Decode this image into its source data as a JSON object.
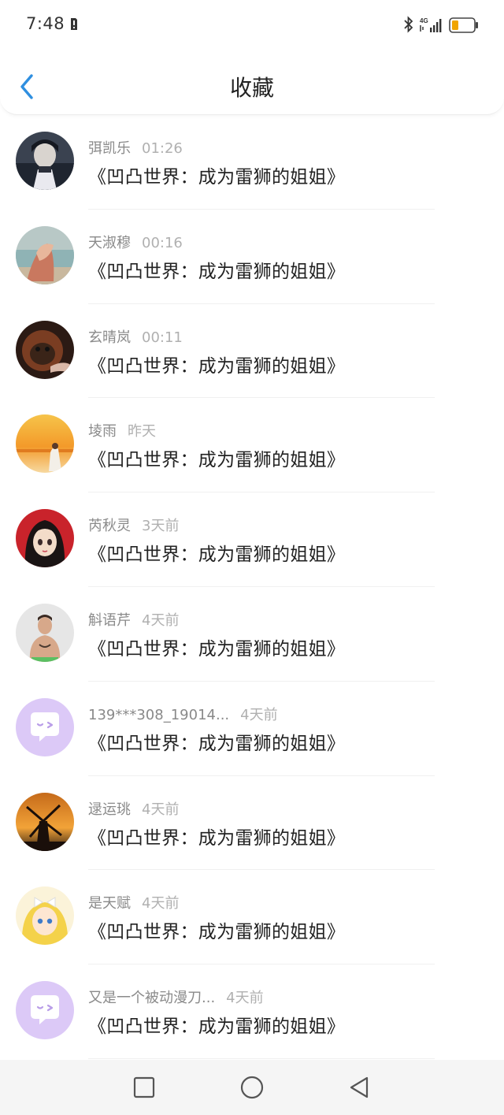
{
  "status_bar": {
    "time": "7:48",
    "icons": [
      "sim-alert-icon",
      "bluetooth-icon",
      "4g-signal-icon",
      "battery-low-icon"
    ],
    "network_label": "4G"
  },
  "header": {
    "title": "收藏",
    "back_icon": "chevron-left-icon"
  },
  "colors": {
    "accent": "#2f8fe0",
    "divider": "#f0f0f0",
    "meta_text": "#999999",
    "title_text": "#222222",
    "default_avatar": "#d9c6f5"
  },
  "items": [
    {
      "name": "弭凯乐",
      "time": "01:26",
      "title": "《凹凸世界：成为雷狮的姐姐》",
      "avatar": "anime-boy-avatar"
    },
    {
      "name": "天淑穆",
      "time": "00:16",
      "title": "《凹凸世界：成为雷狮的姐姐》",
      "avatar": "beach-photo-avatar"
    },
    {
      "name": "玄晴岚",
      "time": "00:11",
      "title": "《凹凸世界：成为雷狮的姐姐》",
      "avatar": "orangutan-avatar"
    },
    {
      "name": "堎雨",
      "time": "昨天",
      "title": "《凹凸世界：成为雷狮的姐姐》",
      "avatar": "sunset-girl-avatar"
    },
    {
      "name": "芮秋灵",
      "time": "3天前",
      "title": "《凹凸世界：成为雷狮的姐姐》",
      "avatar": "illustrated-girl-avatar"
    },
    {
      "name": "斛语芹",
      "time": "4天前",
      "title": "《凹凸世界：成为雷狮的姐姐》",
      "avatar": "tattoo-man-avatar"
    },
    {
      "name": "139***308_19014...",
      "time": "4天前",
      "title": "《凹凸世界：成为雷狮的姐姐》",
      "avatar": "default-chat-avatar"
    },
    {
      "name": "逯运珧",
      "time": "4天前",
      "title": "《凹凸世界：成为雷狮的姐姐》",
      "avatar": "windmill-sunset-avatar"
    },
    {
      "name": "是天赋",
      "time": "4天前",
      "title": "《凹凸世界：成为雷狮的姐姐》",
      "avatar": "anime-blonde-avatar"
    },
    {
      "name": "又是一个被动漫刀...",
      "time": "4天前",
      "title": "《凹凸世界：成为雷狮的姐姐》",
      "avatar": "default-chat-avatar"
    }
  ],
  "nav_bar": {
    "buttons": [
      "recents-square-icon",
      "home-circle-icon",
      "back-triangle-icon"
    ]
  }
}
